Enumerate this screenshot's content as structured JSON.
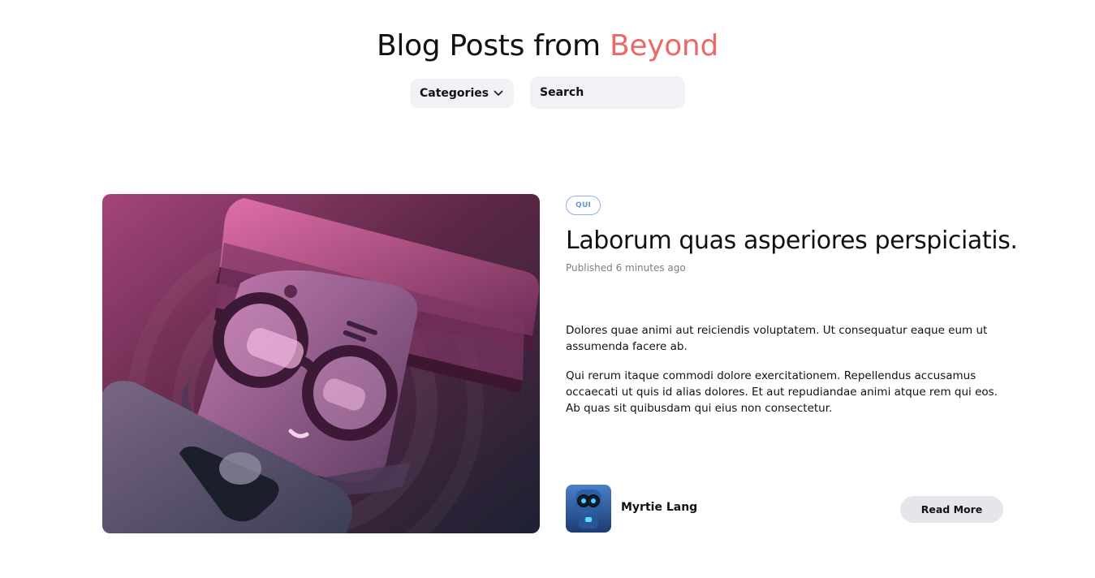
{
  "header": {
    "title_main": "Blog Posts from ",
    "title_accent": "Beyond",
    "accent_color": "#ea6a6a"
  },
  "controls": {
    "categories_label": "Categories",
    "categories_icon": "chevron-down-icon",
    "search_placeholder": "Search"
  },
  "post": {
    "image_icon": "robot-glasses-illustration",
    "tag": "QUI",
    "title": "Laborum quas asperiores perspiciatis.",
    "published": "Published 6 minutes ago",
    "paragraphs": [
      "Dolores quae animi aut reiciendis voluptatem. Ut consequatur eaque eum ut assumenda facere ab.",
      "Qui rerum itaque commodi dolore exercitationem. Repellendus accusamus occaecati ut quis id alias dolores. Et aut repudiandae animi atque rem qui eos. Ab quas sit quibusdam qui eius non consectetur."
    ],
    "author": {
      "name": "Myrtie Lang",
      "avatar_icon": "robot-avatar"
    },
    "read_more_label": "Read More"
  }
}
